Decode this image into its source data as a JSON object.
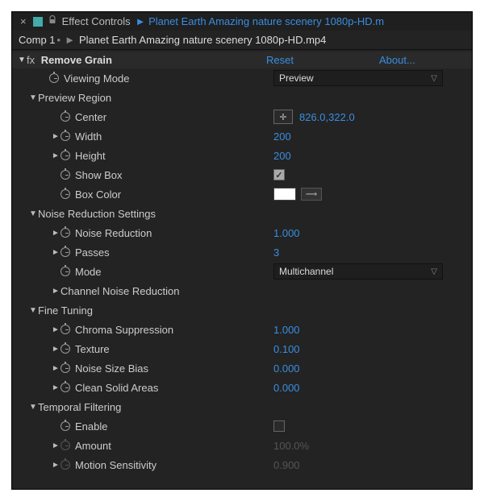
{
  "tab": {
    "close": "×",
    "panel_name": "Effect Controls",
    "asset": "Planet Earth  Amazing nature scenery 1080p-HD.m"
  },
  "breadcrumb": {
    "comp": "Comp 1",
    "sep": "►",
    "asset": "Planet Earth  Amazing nature scenery 1080p-HD.mp4"
  },
  "effect": {
    "fx_label": "fx",
    "name": "Remove Grain",
    "reset": "Reset",
    "about": "About..."
  },
  "props": {
    "viewing_mode": {
      "label": "Viewing Mode",
      "value": "Preview"
    },
    "preview_region": {
      "label": "Preview Region"
    },
    "center": {
      "label": "Center",
      "vx": "826.0",
      "vy": "322.0"
    },
    "width": {
      "label": "Width",
      "value": "200"
    },
    "height": {
      "label": "Height",
      "value": "200"
    },
    "show_box": {
      "label": "Show Box"
    },
    "box_color": {
      "label": "Box Color"
    },
    "nrs": {
      "label": "Noise Reduction Settings"
    },
    "nr": {
      "label": "Noise Reduction",
      "value": "1.000"
    },
    "passes": {
      "label": "Passes",
      "value": "3"
    },
    "mode": {
      "label": "Mode",
      "value": "Multichannel"
    },
    "cnr": {
      "label": "Channel Noise Reduction"
    },
    "ft": {
      "label": "Fine Tuning"
    },
    "chroma": {
      "label": "Chroma Suppression",
      "value": "1.000"
    },
    "texture": {
      "label": "Texture",
      "value": "0.100"
    },
    "nsb": {
      "label": "Noise Size Bias",
      "value": "0.000"
    },
    "csa": {
      "label": "Clean Solid Areas",
      "value": "0.000"
    },
    "tf": {
      "label": "Temporal Filtering"
    },
    "enable": {
      "label": "Enable"
    },
    "amount": {
      "label": "Amount",
      "value": "100.0%"
    },
    "motion": {
      "label": "Motion Sensitivity",
      "value": "0.900"
    }
  }
}
